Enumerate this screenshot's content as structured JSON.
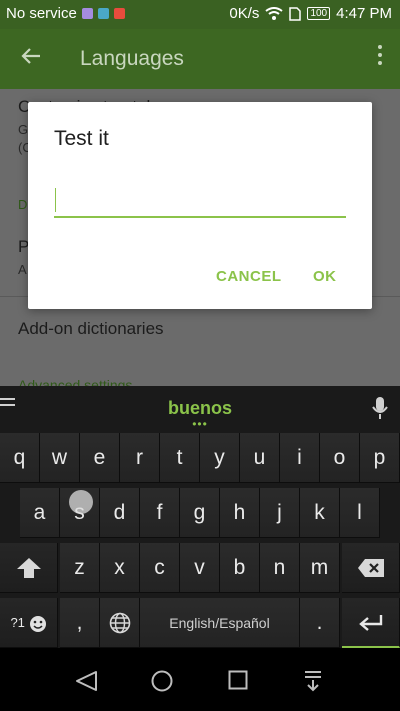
{
  "status_bar": {
    "carrier": "No service",
    "net_speed": "0K/s",
    "battery": "100",
    "time": "4:47 PM"
  },
  "app_bar": {
    "title": "Languages",
    "icons": [
      "back-arrow-icon",
      "more-vert-icon"
    ]
  },
  "settings_list": {
    "items": [
      {
        "label": "Customize top-tab",
        "sub": "G",
        "sub2": "(C"
      },
      {
        "label": "P",
        "sub": "A"
      },
      {
        "label": "Add-on dictionaries"
      },
      {
        "label": "Advanced settings"
      }
    ],
    "category": "D"
  },
  "dialog": {
    "title": "Test it",
    "input_value": "",
    "cancel_label": "CANCEL",
    "ok_label": "OK",
    "accent_color": "#8bc34a"
  },
  "keyboard": {
    "suggestion": "buenos",
    "suggestion_dots": "•••",
    "row1": [
      "q",
      "w",
      "e",
      "r",
      "t",
      "y",
      "u",
      "i",
      "o",
      "p"
    ],
    "row2": [
      "a",
      "s",
      "d",
      "f",
      "g",
      "h",
      "j",
      "k",
      "l"
    ],
    "row3": [
      "z",
      "x",
      "c",
      "v",
      "b",
      "n",
      "m"
    ],
    "symbols_label": "?1",
    "comma": ",",
    "period": ".",
    "space_label": "English/Español",
    "hint": "…"
  },
  "nav_bar": {
    "icons": [
      "back-triangle-icon",
      "home-circle-icon",
      "recents-square-icon",
      "notification-pull-icon"
    ]
  }
}
